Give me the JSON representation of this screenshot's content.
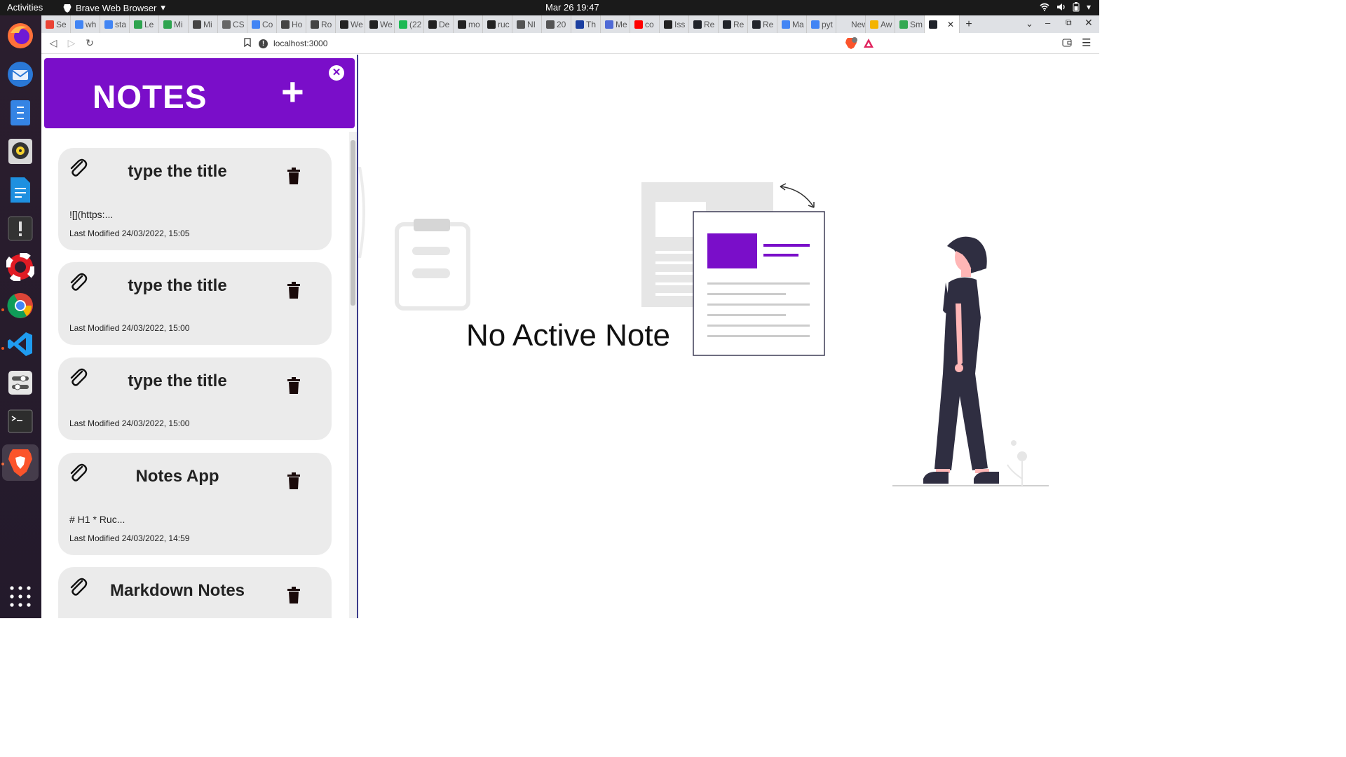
{
  "system": {
    "activities": "Activities",
    "app_name": "Brave Web Browser",
    "clock": "Mar 26  19:47"
  },
  "browser": {
    "tabs": [
      {
        "label": "Se",
        "color": "#ea4335"
      },
      {
        "label": "wh",
        "color": "#4285f4"
      },
      {
        "label": "sta",
        "color": "#4285f4"
      },
      {
        "label": "Le",
        "color": "#2ea44f"
      },
      {
        "label": "Mi",
        "color": "#2ea44f"
      },
      {
        "label": "Mi",
        "color": "#444444"
      },
      {
        "label": "CS",
        "color": "#666666"
      },
      {
        "label": "Co",
        "color": "#4285f4"
      },
      {
        "label": "Ho",
        "color": "#444444"
      },
      {
        "label": "Ro",
        "color": "#444444"
      },
      {
        "label": "We",
        "color": "#222222"
      },
      {
        "label": "We",
        "color": "#222222"
      },
      {
        "label": "(22",
        "color": "#1db954"
      },
      {
        "label": "De",
        "color": "#222222"
      },
      {
        "label": "mo",
        "color": "#222222"
      },
      {
        "label": "ruc",
        "color": "#222222"
      },
      {
        "label": "NI",
        "color": "#555555"
      },
      {
        "label": "20",
        "color": "#555555"
      },
      {
        "label": "Th",
        "color": "#1b3fa0"
      },
      {
        "label": "Me",
        "color": "#4f6ad6"
      },
      {
        "label": "co",
        "color": "#ff0000"
      },
      {
        "label": "Iss",
        "color": "#222222"
      },
      {
        "label": "Re",
        "color": "#20232a"
      },
      {
        "label": "Re",
        "color": "#20232a"
      },
      {
        "label": "Re",
        "color": "#20232a"
      },
      {
        "label": "Ma",
        "color": "#4285f4"
      },
      {
        "label": "pyt",
        "color": "#4285f4"
      },
      {
        "label": "New T",
        "color": "#dfe1e5"
      },
      {
        "label": "Aw",
        "color": "#f4b400"
      },
      {
        "label": "Sm",
        "color": "#34a853"
      },
      {
        "label": "",
        "color": "#20232a",
        "active": true
      }
    ],
    "url": "localhost:3000"
  },
  "notes": {
    "header_title": "NOTES",
    "add_symbol": "+",
    "close_symbol": "✕",
    "items": [
      {
        "title": "type the title",
        "preview": "![](https:...",
        "modified": "Last Modified 24/03/2022, 15:05"
      },
      {
        "title": "type the title",
        "preview": "",
        "modified": "Last Modified 24/03/2022, 15:00"
      },
      {
        "title": "type the title",
        "preview": "",
        "modified": "Last Modified 24/03/2022, 15:00"
      },
      {
        "title": "Notes App",
        "preview": "# H1 * Ruc...",
        "modified": "Last Modified 24/03/2022, 14:59"
      },
      {
        "title": "Markdown Notes",
        "preview": "",
        "modified": ""
      }
    ]
  },
  "main": {
    "empty_message": "No Active Note",
    "accent_color": "#7a0ec9"
  }
}
